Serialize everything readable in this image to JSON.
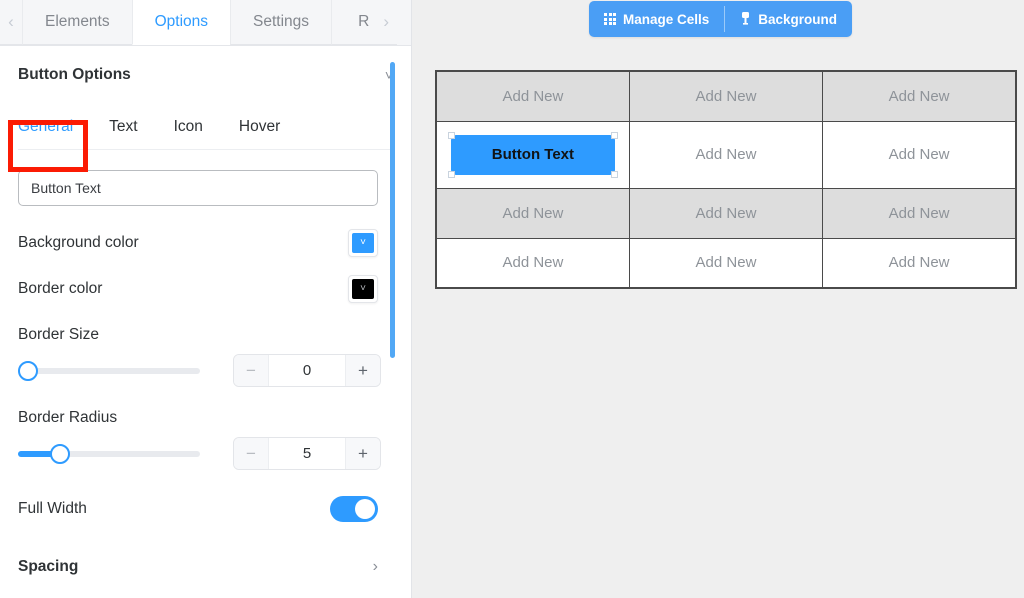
{
  "tabs": {
    "prev_icon": "chevron-left-icon",
    "next_icon": "chevron-right-icon",
    "items": [
      {
        "label": "Elements",
        "active": false
      },
      {
        "label": "Options",
        "active": true
      },
      {
        "label": "Settings",
        "active": false
      },
      {
        "label": "R",
        "active": false
      }
    ]
  },
  "panel": {
    "section_title": "Button Options",
    "collapse_icon": "chevron-down-icon",
    "subtabs": [
      {
        "label": "General",
        "active": true
      },
      {
        "label": "Text",
        "active": false
      },
      {
        "label": "Icon",
        "active": false
      },
      {
        "label": "Hover",
        "active": false
      }
    ],
    "button_text_value": "Button Text",
    "button_text_placeholder": "Button Text",
    "background_color": {
      "label": "Background color",
      "value": "#2e9bff",
      "icon": "chevron-down-icon"
    },
    "border_color": {
      "label": "Border color",
      "value": "#000000",
      "icon": "chevron-down-icon"
    },
    "border_size": {
      "label": "Border Size",
      "value": "0",
      "percent": 0,
      "minus": "−",
      "plus": "+"
    },
    "border_radius": {
      "label": "Border Radius",
      "value": "5",
      "percent": 20,
      "minus": "−",
      "plus": "+"
    },
    "full_width": {
      "label": "Full Width",
      "state": "on"
    },
    "spacing": {
      "label": "Spacing",
      "icon": "chevron-right-icon"
    }
  },
  "canvas": {
    "toolbar": {
      "manage_cells": {
        "label": "Manage Cells",
        "icon": "grid-icon"
      },
      "background": {
        "label": "Background",
        "icon": "lamp-icon"
      }
    },
    "table": {
      "rows": [
        {
          "style": "gray",
          "cells": [
            {
              "type": "text",
              "label": "Add New"
            },
            {
              "type": "text",
              "label": "Add New"
            },
            {
              "type": "text",
              "label": "Add New"
            }
          ]
        },
        {
          "style": "white",
          "cells": [
            {
              "type": "button",
              "label": "Button Text",
              "selected": true
            },
            {
              "type": "text",
              "label": "Add New"
            },
            {
              "type": "text",
              "label": "Add New"
            }
          ]
        },
        {
          "style": "gray",
          "cells": [
            {
              "type": "text",
              "label": "Add New"
            },
            {
              "type": "text",
              "label": "Add New"
            },
            {
              "type": "text",
              "label": "Add New"
            }
          ]
        },
        {
          "style": "white",
          "cells": [
            {
              "type": "text",
              "label": "Add New"
            },
            {
              "type": "text",
              "label": "Add New"
            },
            {
              "type": "text",
              "label": "Add New"
            }
          ]
        }
      ]
    }
  },
  "annotation": {
    "type": "highlight-rectangle",
    "color": "#fb1b04",
    "target": "General"
  }
}
